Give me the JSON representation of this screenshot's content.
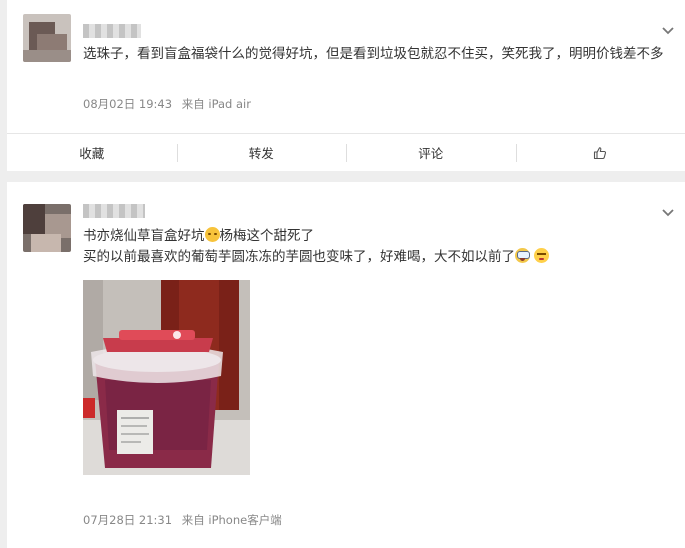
{
  "posts": [
    {
      "username": "",
      "text": "选珠子，看到盲盒福袋什么的觉得好坑，但是看到垃圾包就忍不住买，笑死我了，明明价钱差不多",
      "date": "08月02日 19:43",
      "source": "来自 iPad air",
      "actions": {
        "collect": "收藏",
        "repost": "转发",
        "comment": "评论",
        "like_icon": "thumbs-up-icon"
      }
    },
    {
      "username": "",
      "line1_a": "书亦烧仙草盲盒好坑",
      "line1_b": "杨梅这个甜死了",
      "line2": "买的以前最喜欢的葡萄芋圆冻冻的芋圆也变味了，好难喝，大不如以前了",
      "date": "07月28日 21:31",
      "source": "来自 iPhone客户端"
    }
  ],
  "colors": {
    "page_bg": "#eeeeee",
    "card_bg": "#ffffff",
    "meta": "#888888"
  }
}
